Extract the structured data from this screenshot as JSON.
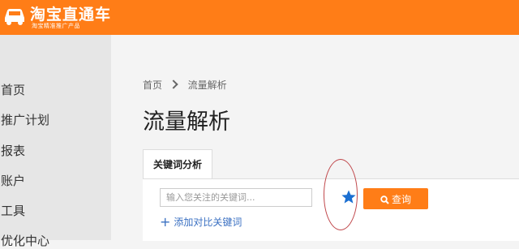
{
  "header": {
    "logo_title": "淘宝直通车",
    "logo_subtitle": "淘宝精准推广产品",
    "brand_color": "#ff7d17"
  },
  "sidebar": {
    "items": [
      {
        "label": "首页"
      },
      {
        "label": "推广计划"
      },
      {
        "label": "报表"
      },
      {
        "label": "账户"
      },
      {
        "label": "工具"
      },
      {
        "label": "优化中心"
      }
    ]
  },
  "main": {
    "breadcrumb": {
      "home": "首页",
      "current": "流量解析"
    },
    "page_title": "流量解析",
    "tab": {
      "label": "关键词分析"
    },
    "search": {
      "placeholder": "输入您关注的关键词...",
      "value": ""
    },
    "favorite_icon": "star-icon",
    "query_button": {
      "label": "查询",
      "icon": "search-icon"
    },
    "add_compare": {
      "label": "添加对比关键词",
      "icon": "plus-icon"
    }
  },
  "colors": {
    "accent": "#ff7d17",
    "link": "#3a70c2",
    "star": "#1b6fd1",
    "annotation": "#c0474b"
  }
}
